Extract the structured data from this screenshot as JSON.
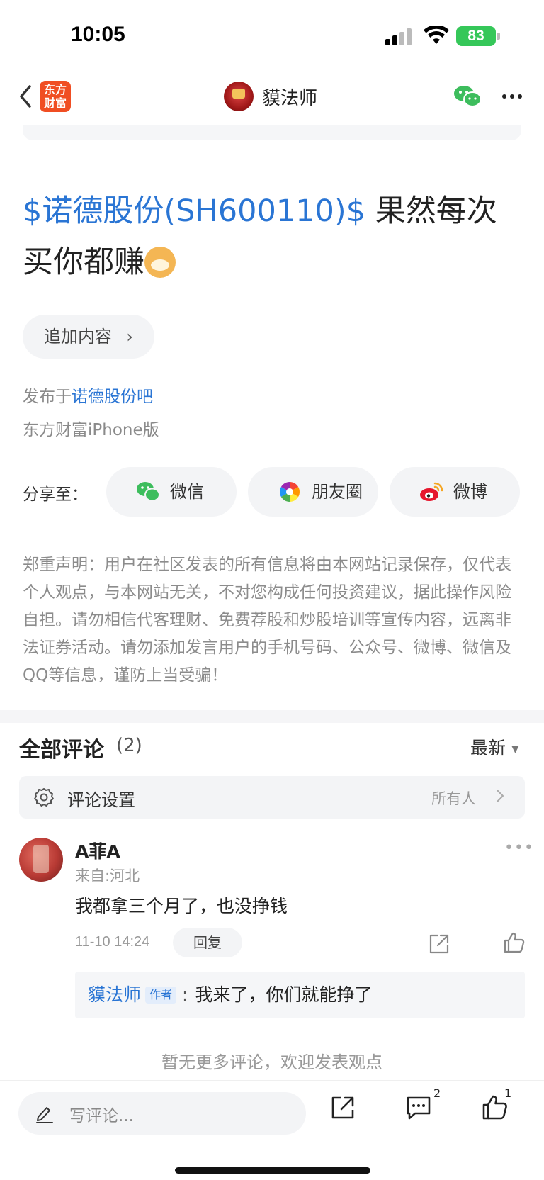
{
  "status_bar": {
    "time": "10:05",
    "battery": "83"
  },
  "nav": {
    "app_logo": "东方\n财富",
    "title": "貘法师"
  },
  "post": {
    "stock_link": "$诺德股份(SH600110)$",
    "text": " 果然每次买你都赚",
    "append_label": "追加内容",
    "posted_prefix": "发布于",
    "posted_bar": "诺德股份吧",
    "client": "东方财富iPhone版",
    "share_label": "分享至：",
    "share_wechat": "微信",
    "share_moments": "朋友圈",
    "share_weibo": "微博",
    "disclaimer": "郑重声明：用户在社区发表的所有信息将由本网站记录保存，仅代表个人观点，与本网站无关，不对您构成任何投资建议，据此操作风险自担。请勿相信代客理财、免费荐股和炒股培训等宣传内容，远离非法证券活动。请勿添加发言用户的手机号码、公众号、微博、微信及QQ等信息，谨防上当受骗！"
  },
  "comments": {
    "title": "全部评论",
    "count": "(2)",
    "sort": "最新",
    "settings_label": "评论设置",
    "settings_value": "所有人",
    "items": [
      {
        "name": "A菲A",
        "location": "来自:河北",
        "text": "我都拿三个月了，也没挣钱",
        "time": "11-10 14:24",
        "reply_label": "回复",
        "reply": {
          "author": "貘法师",
          "tag": "作者",
          "sep": ":",
          "text": "我来了，你们就能挣了"
        }
      }
    ],
    "no_more": "暂无更多评论，欢迎发表观点"
  },
  "bottom_bar": {
    "placeholder": "写评论...",
    "comment_count": "2",
    "like_count": "1"
  },
  "colors": {
    "link": "#2a75d4",
    "brand": "#f04e23",
    "battery": "#35c759"
  }
}
